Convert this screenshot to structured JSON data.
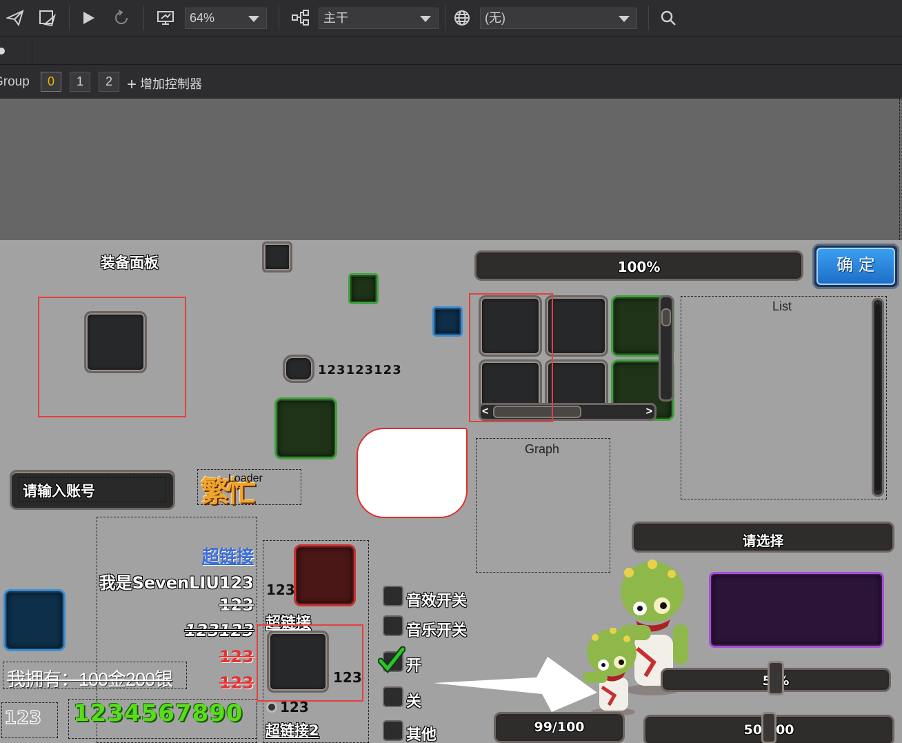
{
  "toolbar": {
    "zoom": "64%",
    "branch": "主干",
    "language": "(无)"
  },
  "controller": {
    "label": "Group",
    "pages": [
      "0",
      "1",
      "2"
    ],
    "add_label": "增加控制器"
  },
  "stage": {
    "equip_title": "装备面板",
    "progress_top": "100%",
    "confirm_button": "确 定",
    "counter_text": "123123123",
    "list_label": "List",
    "graph_label": "Graph",
    "loader_label": "Loader",
    "loader_image_text": "繁忙",
    "account_placeholder": "请输入账号",
    "select_label": "请选择",
    "rich_text": {
      "link1": "超链接",
      "name_line": "我是SevenLIU123",
      "line3": "123",
      "line4": "123123",
      "line5": "123",
      "line6": "123"
    },
    "owned_text": "我拥有：100金200银",
    "boxed_num": "123",
    "big_number": "1234567890",
    "mid_col": {
      "label1": "123",
      "link2": "超链接",
      "label2": "123",
      "radio_label": "123",
      "link3": "超链接2"
    },
    "checkboxes": [
      {
        "label": "音效开关",
        "checked": false
      },
      {
        "label": "音乐开关",
        "checked": false
      },
      {
        "label": "开",
        "checked": true
      },
      {
        "label": "关",
        "checked": false
      },
      {
        "label": "其他",
        "checked": false
      }
    ],
    "slider_text": "5 %",
    "slider_value": 0.5,
    "hp_bar": "99/100",
    "hp_value": 0.99,
    "exp_bar": "50/100",
    "exp_value": 0.5,
    "colors": {
      "stage_bg": "#a2a2a2",
      "link_blue": "#3a6ed8",
      "number_green": "#5adc1c",
      "confirm_blue": "#1e78d0",
      "highlight_red": "#e34040"
    }
  }
}
